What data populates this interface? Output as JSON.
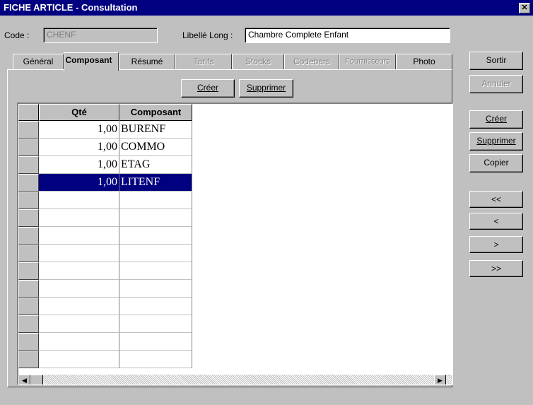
{
  "window": {
    "title": "FICHE ARTICLE - Consultation",
    "close_glyph": "✕"
  },
  "code": {
    "label": "Code :",
    "value": "CHENF"
  },
  "libelle": {
    "label": "Libellé Long :",
    "value": "Chambre Complete Enfant"
  },
  "tabs": [
    {
      "label": "Général",
      "active": false,
      "enabled": true
    },
    {
      "label": "Composant",
      "active": true,
      "enabled": true
    },
    {
      "label": "Résumé",
      "active": false,
      "enabled": true
    },
    {
      "label": "Tarifs",
      "active": false,
      "enabled": false
    },
    {
      "label": "Stocks",
      "active": false,
      "enabled": false
    },
    {
      "label": "Codebars",
      "active": false,
      "enabled": false
    },
    {
      "label": "Fournisseurs",
      "active": false,
      "enabled": false
    },
    {
      "label": "Photo",
      "active": false,
      "enabled": true
    }
  ],
  "panel_buttons": {
    "create": "Créer",
    "delete": "Supprimer"
  },
  "grid": {
    "columns": [
      "Qté",
      "Composant"
    ],
    "rows": [
      {
        "qty": "1,00",
        "comp": "BURENF",
        "selected": false
      },
      {
        "qty": "1,00",
        "comp": "COMMO",
        "selected": false
      },
      {
        "qty": "1,00",
        "comp": "ETAG",
        "selected": false
      },
      {
        "qty": "1,00",
        "comp": "LITENF",
        "selected": true
      }
    ],
    "empty_rows": 10
  },
  "side_buttons": {
    "exit": "Sortir",
    "cancel": "Annuler",
    "create": "Créer",
    "delete": "Supprimer",
    "copy": "Copier",
    "first": "<<",
    "prev": "<",
    "next": ">",
    "last": ">>"
  },
  "colors": {
    "titlebar": "#000080",
    "selection": "#000080",
    "face": "#c0c0c0"
  }
}
